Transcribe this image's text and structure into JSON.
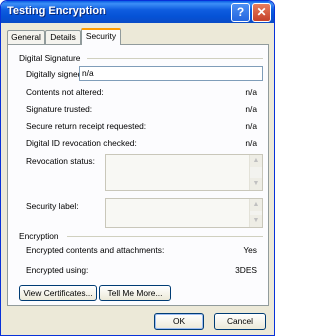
{
  "window": {
    "title": "Testing Encryption",
    "help_glyph": "?",
    "close_glyph": "✕"
  },
  "tabs": [
    {
      "label": "General",
      "active": false
    },
    {
      "label": "Details",
      "active": false
    },
    {
      "label": "Security",
      "active": true
    }
  ],
  "digital_signature": {
    "group_label": "Digital Signature",
    "signed_by_label": "Digitally signed by:",
    "signed_by_value": "n/a",
    "rows": [
      {
        "label": "Contents not altered:",
        "value": "n/a"
      },
      {
        "label": "Signature trusted:",
        "value": "n/a"
      },
      {
        "label": "Secure return receipt requested:",
        "value": "n/a"
      },
      {
        "label": "Digital ID revocation checked:",
        "value": "n/a"
      }
    ],
    "revocation_status_label": "Revocation status:",
    "security_label_label": "Security label:"
  },
  "encryption": {
    "group_label": "Encryption",
    "rows": [
      {
        "label": "Encrypted contents and attachments:",
        "value": "Yes"
      },
      {
        "label": "Encrypted using:",
        "value": "3DES"
      }
    ]
  },
  "buttons": {
    "view_certificates": "View Certificates...",
    "tell_me_more": "Tell Me More...",
    "ok": "OK",
    "cancel": "Cancel"
  },
  "icons": {
    "scroll_up": "▲",
    "scroll_down": "▼"
  }
}
